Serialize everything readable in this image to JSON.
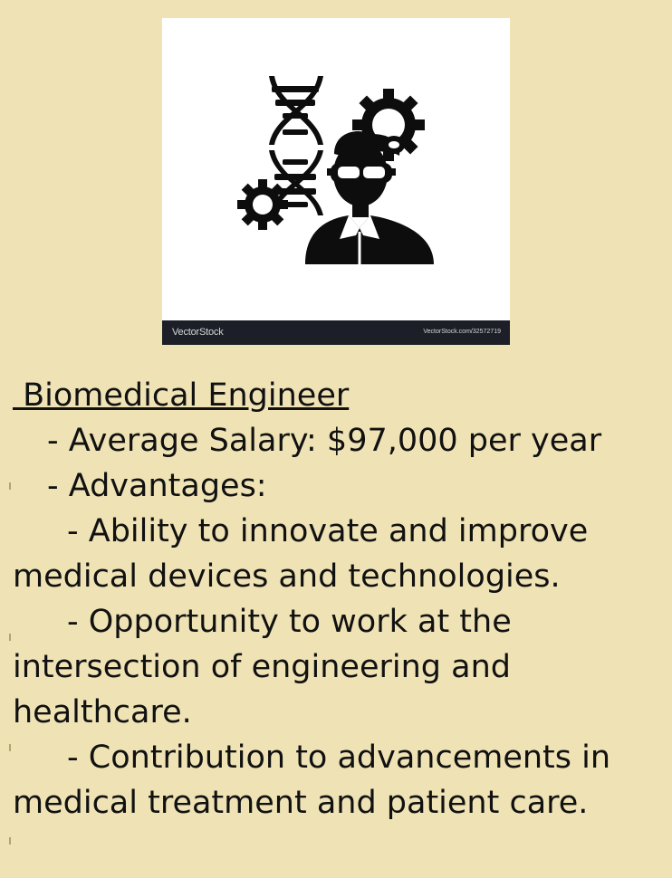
{
  "image": {
    "watermark_brand": "VectorStock",
    "watermark_url": "VectorStock.com/32572719",
    "icons": [
      "dna-icon",
      "gear-icon",
      "engineer-avatar-icon"
    ]
  },
  "career": {
    "title": " Biomedical Engineer",
    "salary_label": "- Average Salary:",
    "salary_value": " $97,000 per year",
    "advantages_label": "- Advantages:",
    "advantages": [
      "- Ability to innovate and improve medical devices and technologies.",
      "- Opportunity to work at the intersection of engineering and healthcare.",
      "- Contribution to advancements in medical treatment and patient care."
    ]
  },
  "colors": {
    "background": "#efe3b5",
    "text": "#111111",
    "watermark_bar": "#1c1f27"
  }
}
